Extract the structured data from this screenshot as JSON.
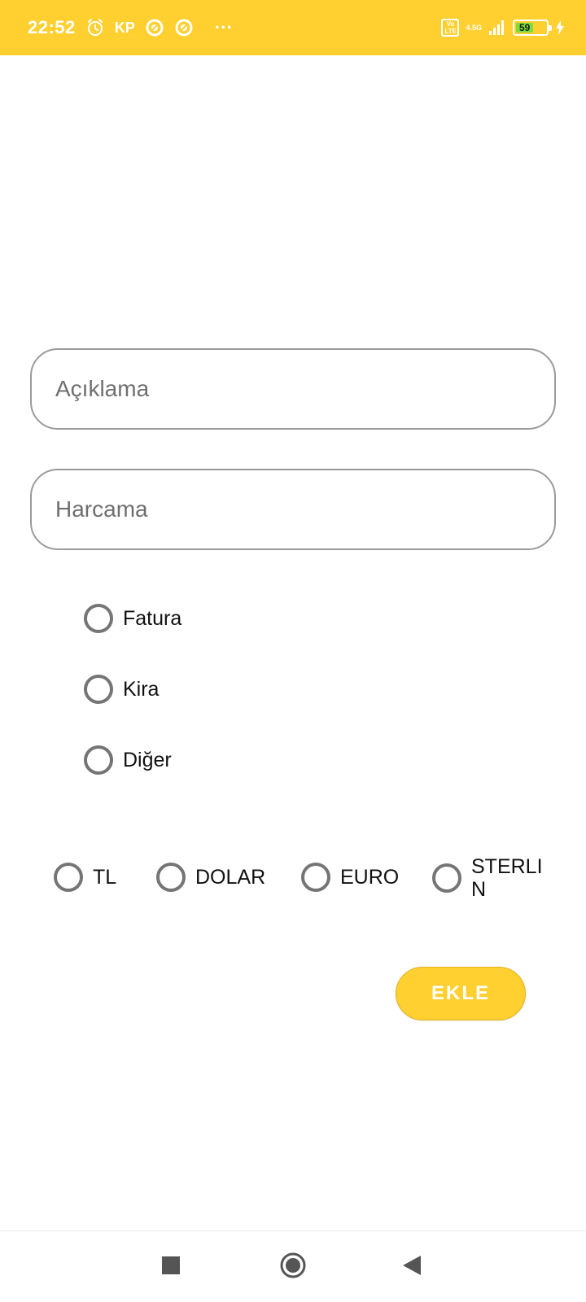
{
  "status_bar": {
    "time": "22:52",
    "carrier": "KP",
    "more": "···",
    "volte_top": "Vo",
    "volte_bottom": "LTE",
    "network": "4.5G",
    "battery_level": "59",
    "battery_percent": 59,
    "icons": [
      "alarm-icon",
      "app-notification-icon",
      "app-notification-icon",
      "volte-icon",
      "signal-icon",
      "battery-icon",
      "charging-icon"
    ],
    "color": "#FFD030"
  },
  "form": {
    "description_placeholder": "Açıklama",
    "amount_placeholder": "Harcama",
    "categories": [
      "Fatura",
      "Kira",
      "Diğer"
    ],
    "currencies": [
      "TL",
      "DOLAR",
      "EURO",
      "STERLIN"
    ],
    "submit_label": "EKLE"
  },
  "nav": {
    "icons": [
      "recents-icon",
      "home-icon",
      "back-icon"
    ]
  },
  "colors": {
    "accent": "#FFD030",
    "field_border": "#9a9a9a",
    "radio_border": "#757575"
  }
}
